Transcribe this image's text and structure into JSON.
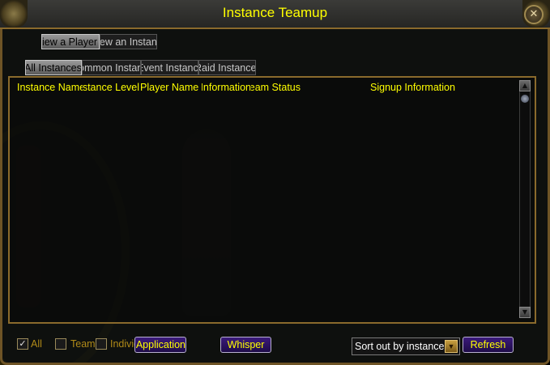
{
  "window": {
    "title": "Instance Teamup"
  },
  "top_tabs": [
    {
      "label": "View a Player",
      "active": true
    },
    {
      "label": "View an Instance",
      "active": false
    }
  ],
  "sub_tabs": [
    {
      "label": "All Instances",
      "active": true
    },
    {
      "label": "Common Instance",
      "active": false
    },
    {
      "label": "Event Instance",
      "active": false
    },
    {
      "label": "Raid Instance",
      "active": false
    }
  ],
  "columns": [
    "Instance Name",
    "Instance Level",
    "Player Name",
    "Team Information",
    "Team Status",
    "Signup Information"
  ],
  "filters": [
    {
      "label": "All",
      "checked": true
    },
    {
      "label": "Team",
      "checked": false
    },
    {
      "label": "Individual",
      "checked": false
    }
  ],
  "buttons": {
    "apply": "Team Application",
    "whisper": "Whisper",
    "refresh": "Refresh"
  },
  "sort": {
    "value": "Sort out by instance"
  },
  "icons": {
    "close": "close-icon",
    "scroll_up": "up-arrow-icon",
    "scroll_down": "down-arrow-icon",
    "dropdown": "chevron-down-icon"
  },
  "colors": {
    "title_text": "#ffff00",
    "frame_gold": "#8a6a2c",
    "button_purple": "#3b1a7a",
    "checkbox_label": "#b08a18"
  }
}
